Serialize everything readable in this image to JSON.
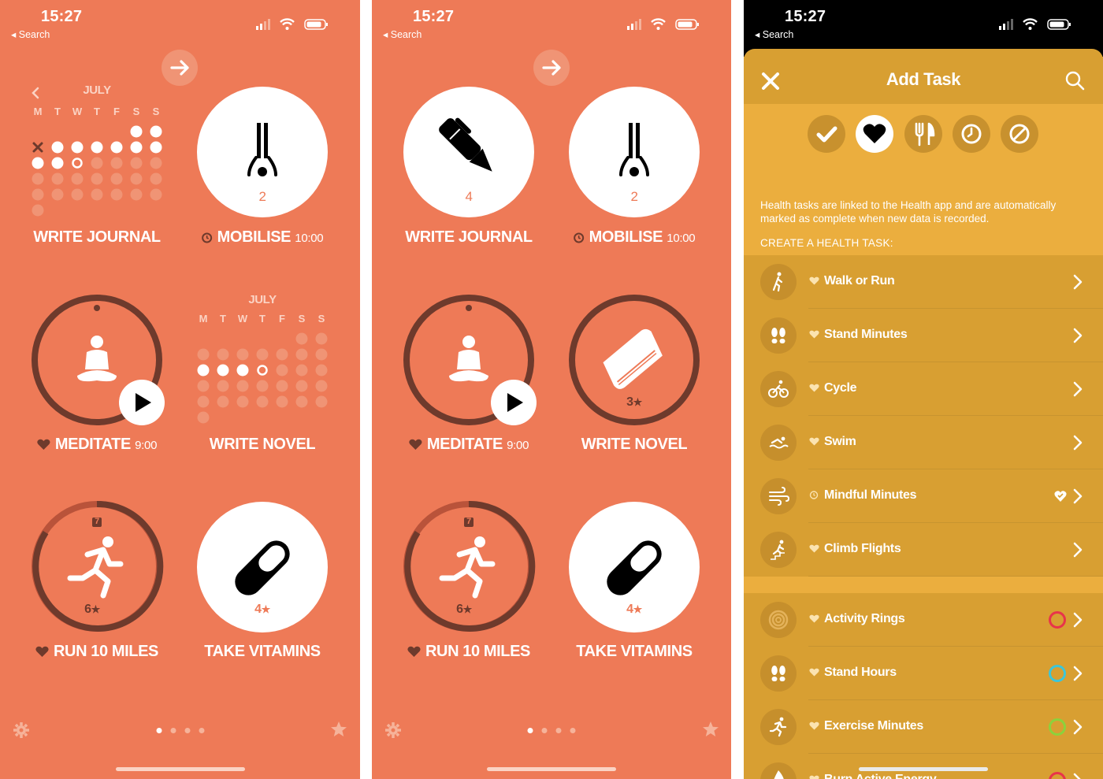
{
  "status": {
    "time": "15:27",
    "back": "◂ Search"
  },
  "screen1": {
    "calendar1_month": "JULY",
    "calendar2_month": "JULY",
    "weekdays": [
      "M",
      "T",
      "W",
      "T",
      "F",
      "S",
      "S"
    ],
    "labels": {
      "write_journal": "WRITE JOURNAL",
      "mobilise": "MOBILISE",
      "mobilise_time": "10:00",
      "meditate": "MEDITATE",
      "meditate_time": "9:00",
      "write_novel": "WRITE NOVEL",
      "run": "RUN 10 MILES",
      "vitamins": "TAKE VITAMINS"
    },
    "counts": {
      "mobilise": "2",
      "run_badge": "7",
      "run": "6",
      "vitamins": "4"
    }
  },
  "screen2": {
    "labels": {
      "write_journal": "WRITE JOURNAL",
      "mobilise": "MOBILISE",
      "mobilise_time": "10:00",
      "meditate": "MEDITATE",
      "meditate_time": "9:00",
      "write_novel": "WRITE NOVEL",
      "run": "RUN 10 MILES",
      "vitamins": "TAKE VITAMINS"
    },
    "counts": {
      "journal": "4",
      "mobilise": "2",
      "novel": "3",
      "run_badge": "7",
      "run": "6",
      "vitamins": "4"
    }
  },
  "screen3": {
    "title": "Add Task",
    "info": "Health tasks are linked to the Health app and are automatically marked as complete when new data is recorded.",
    "create_label": "CREATE A HEALTH TASK:",
    "tasks": [
      {
        "name": "Walk or Run",
        "icon": "walk-icon"
      },
      {
        "name": "Stand Minutes",
        "icon": "footprints-icon"
      },
      {
        "name": "Cycle",
        "icon": "cycle-icon"
      },
      {
        "name": "Swim",
        "icon": "swim-icon"
      },
      {
        "name": "Mindful Minutes",
        "icon": "wind-icon"
      },
      {
        "name": "Climb Flights",
        "icon": "stairs-icon"
      }
    ],
    "ring_tasks": [
      {
        "name": "Activity Rings",
        "icon": "rings-icon",
        "ring_color": "#e8344a"
      },
      {
        "name": "Stand Hours",
        "icon": "footprints-icon",
        "ring_color": "#3cc6d9"
      },
      {
        "name": "Exercise Minutes",
        "icon": "run-icon",
        "ring_color": "#8bd23c"
      },
      {
        "name": "Burn Active Energy",
        "icon": "flame-icon",
        "ring_color": "#e8344a"
      }
    ]
  },
  "colors": {
    "orange": "#ee7a57",
    "brown": "#6e3a2c",
    "gold": "#d89f32",
    "gold_light": "#ebae3e"
  }
}
